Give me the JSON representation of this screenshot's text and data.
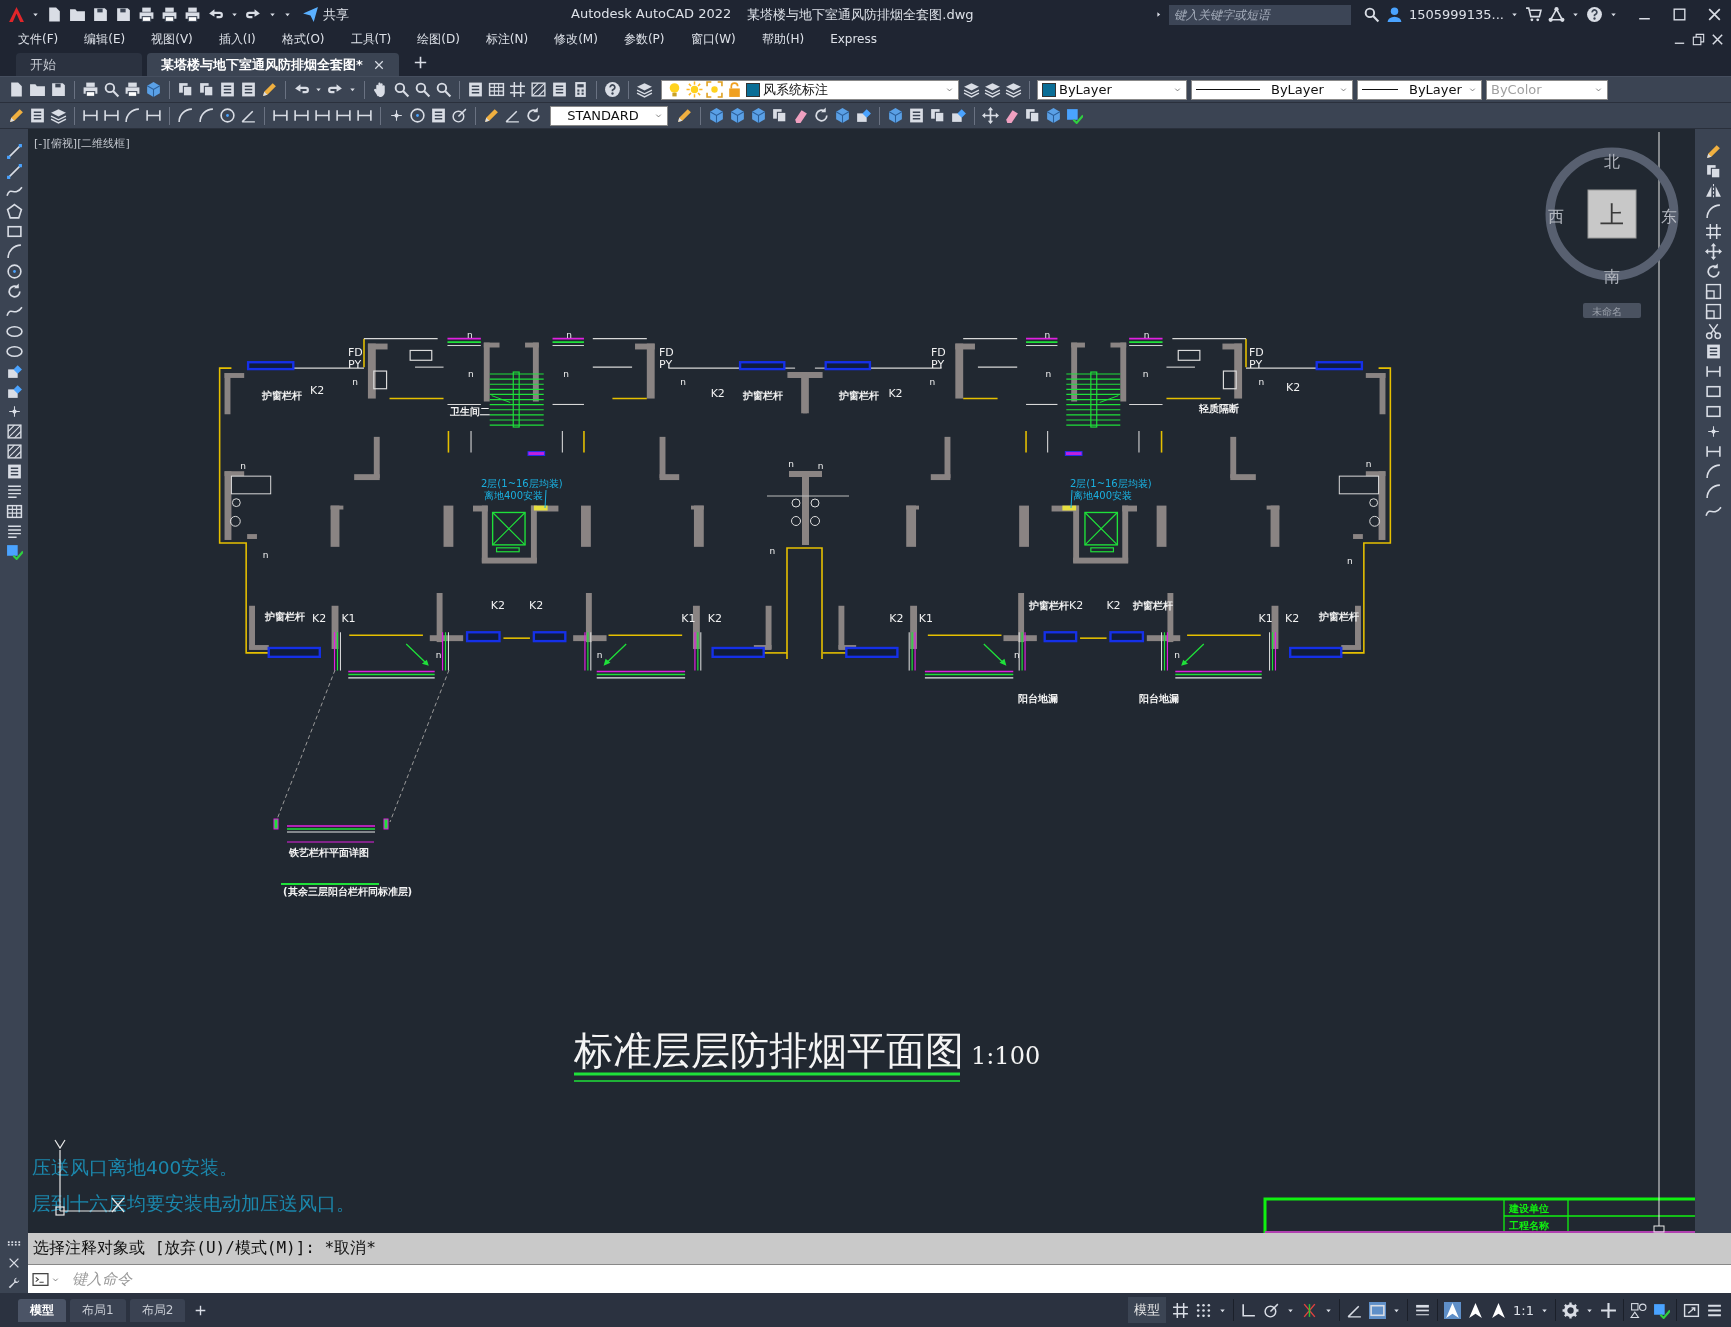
{
  "window": {
    "app": "Autodesk AutoCAD 2022",
    "file": "某塔楼与地下室通风防排烟全套图.dwg",
    "share": "共享",
    "search_placeholder": "键入关键字或短语",
    "user": "1505999135..."
  },
  "menu": [
    "文件(F)",
    "编辑(E)",
    "视图(V)",
    "插入(I)",
    "格式(O)",
    "工具(T)",
    "绘图(D)",
    "标注(N)",
    "修改(M)",
    "参数(P)",
    "窗口(W)",
    "帮助(H)",
    "Express"
  ],
  "tabs": [
    {
      "label": "开始",
      "selected": false
    },
    {
      "label": "某塔楼与地下室通风防排烟全套图*",
      "selected": true
    }
  ],
  "properties": {
    "layer": "风系统标注",
    "color_setting": "ByLayer",
    "linetype": "ByLayer",
    "lineweight": "ByLayer",
    "plot_style": {
      "value": "ByColor",
      "disabled": true
    },
    "text_style": "STANDARD"
  },
  "viewport": {
    "label": "[-][俯视][二维线框]",
    "viewcube": {
      "north": "北",
      "west": "西",
      "east": "东",
      "south": "南",
      "face": "上"
    },
    "ucs_button": "未命名"
  },
  "drawing": {
    "labels": [
      "FD",
      "PY",
      "FD",
      "PY",
      "FD",
      "PY",
      "FD",
      "PY",
      "护窗栏杆",
      "K2",
      "K2",
      "护窗栏杆",
      "护窗栏杆",
      "K2",
      "K2",
      "卫生间二",
      "轻质隔断",
      "护窗栏杆",
      "K2",
      "K1",
      "K2",
      "K2",
      "K1",
      "K2",
      "K2",
      "K1",
      "护窗栏杆",
      "K2",
      "K2",
      "护窗栏杆",
      "K1",
      "K2",
      "护窗栏杆",
      "阳台地漏",
      "阳台地漏",
      "n",
      "n",
      "n",
      "n",
      "n",
      "n",
      "n",
      "n",
      "n",
      "n",
      "n",
      "n",
      "n",
      "n",
      "n",
      "n",
      "n",
      "n",
      "n",
      "n",
      "n",
      "n",
      "n"
    ],
    "notes": [
      "2层(1~16层均装)",
      "离地400安装",
      "2层(1~16层均装)",
      "离地400安装"
    ],
    "detail_labels": [
      "铁艺栏杆平面详图",
      "(其余三层阳台栏杆同标准层)"
    ],
    "title": "标准层层防排烟平面图",
    "scale": "1:100",
    "general_notes": [
      "压送风口离地400安装。",
      "层到十六层均要安装电动加压送风口。"
    ],
    "title_block": [
      "建设单位",
      "工程名称"
    ]
  },
  "command": {
    "history": "选择注释对象或 [放弃(U)/模式(M)]: *取消*",
    "placeholder": "键入命令"
  },
  "layout_tabs": [
    {
      "label": "模型",
      "selected": true
    },
    {
      "label": "布局1",
      "selected": false
    },
    {
      "label": "布局2",
      "selected": false
    }
  ],
  "status_bar": {
    "space": "模型",
    "scale": "1:1"
  }
}
